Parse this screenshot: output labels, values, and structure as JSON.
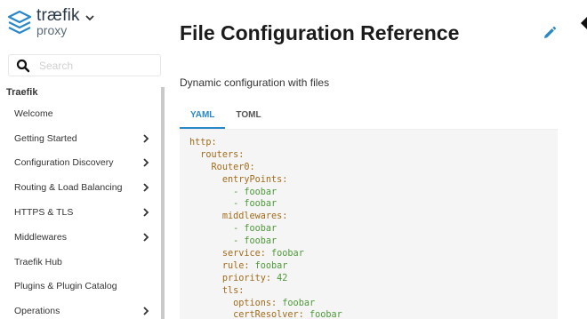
{
  "brand": {
    "name": "træfik",
    "sub": "proxy",
    "colors": {
      "accent": "#2b88c8",
      "logo": "#2b88c8",
      "key": "#a26b1a",
      "value": "#4f9a3a"
    }
  },
  "search": {
    "placeholder": "Search"
  },
  "sidebar": {
    "section_title": "Traefik",
    "items": [
      {
        "label": "Welcome",
        "has_children": false
      },
      {
        "label": "Getting Started",
        "has_children": true
      },
      {
        "label": "Configuration Discovery",
        "has_children": true
      },
      {
        "label": "Routing & Load Balancing",
        "has_children": true
      },
      {
        "label": "HTTPS & TLS",
        "has_children": true
      },
      {
        "label": "Middlewares",
        "has_children": true
      },
      {
        "label": "Traefik Hub",
        "has_children": false
      },
      {
        "label": "Plugins & Plugin Catalog",
        "has_children": false
      },
      {
        "label": "Operations",
        "has_children": true
      }
    ]
  },
  "main": {
    "title": "File Configuration Reference",
    "subtitle": "Dynamic configuration with files",
    "tabs": [
      {
        "label": "YAML",
        "active": true
      },
      {
        "label": "TOML",
        "active": false
      }
    ],
    "code_lines": [
      {
        "indent": "",
        "key": "http:",
        "value": ""
      },
      {
        "indent": "  ",
        "key": "routers:",
        "value": ""
      },
      {
        "indent": "    ",
        "key": "Router0:",
        "value": ""
      },
      {
        "indent": "      ",
        "key": "entryPoints:",
        "value": ""
      },
      {
        "indent": "        ",
        "key": "",
        "value": "- foobar"
      },
      {
        "indent": "        ",
        "key": "",
        "value": "- foobar"
      },
      {
        "indent": "      ",
        "key": "middlewares:",
        "value": ""
      },
      {
        "indent": "        ",
        "key": "",
        "value": "- foobar"
      },
      {
        "indent": "        ",
        "key": "",
        "value": "- foobar"
      },
      {
        "indent": "      ",
        "key": "service:",
        "value": " foobar"
      },
      {
        "indent": "      ",
        "key": "rule:",
        "value": " foobar"
      },
      {
        "indent": "      ",
        "key": "priority:",
        "value": " 42"
      },
      {
        "indent": "      ",
        "key": "tls:",
        "value": ""
      },
      {
        "indent": "        ",
        "key": "options:",
        "value": " foobar"
      },
      {
        "indent": "        ",
        "key": "certResolver:",
        "value": " foobar"
      }
    ]
  },
  "icons": {
    "logo": "traefik-logo-icon",
    "brand_menu": "chevron-down-icon",
    "search": "search-icon",
    "nav_chevron": "chevron-right-icon",
    "edit": "pencil-icon"
  }
}
